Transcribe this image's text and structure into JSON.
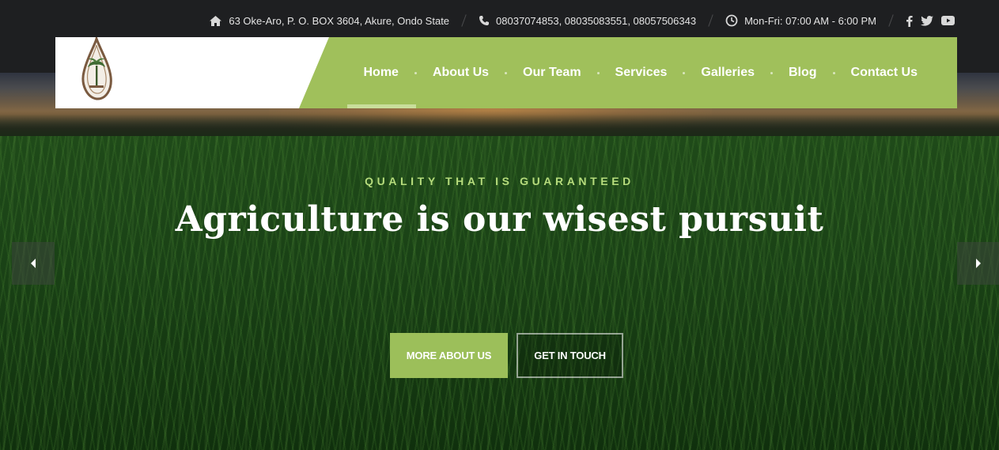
{
  "topbar": {
    "address": "63 Oke-Aro, P. O. BOX 3604, Akure, Ondo State",
    "phones": "08037074853, 08035083551, 08057506343",
    "hours": "Mon-Fri: 07:00 AM - 6:00 PM",
    "social": [
      "facebook-icon",
      "twitter-icon",
      "youtube-icon"
    ]
  },
  "nav": {
    "items": [
      {
        "label": "Home",
        "active": true
      },
      {
        "label": "About Us"
      },
      {
        "label": "Our Team"
      },
      {
        "label": "Services"
      },
      {
        "label": "Galleries"
      },
      {
        "label": "Blog"
      },
      {
        "label": "Contact Us"
      }
    ]
  },
  "hero": {
    "tagline": "QUALITY THAT IS GUARANTEED",
    "headline": "Agriculture is our wisest pursuit",
    "primary_button": "MORE ABOUT US",
    "secondary_button": "GET IN TOUCH"
  },
  "colors": {
    "accent": "#a0c05b",
    "tagline": "#b6dc7c",
    "topbar_bg": "#1e1f21"
  }
}
